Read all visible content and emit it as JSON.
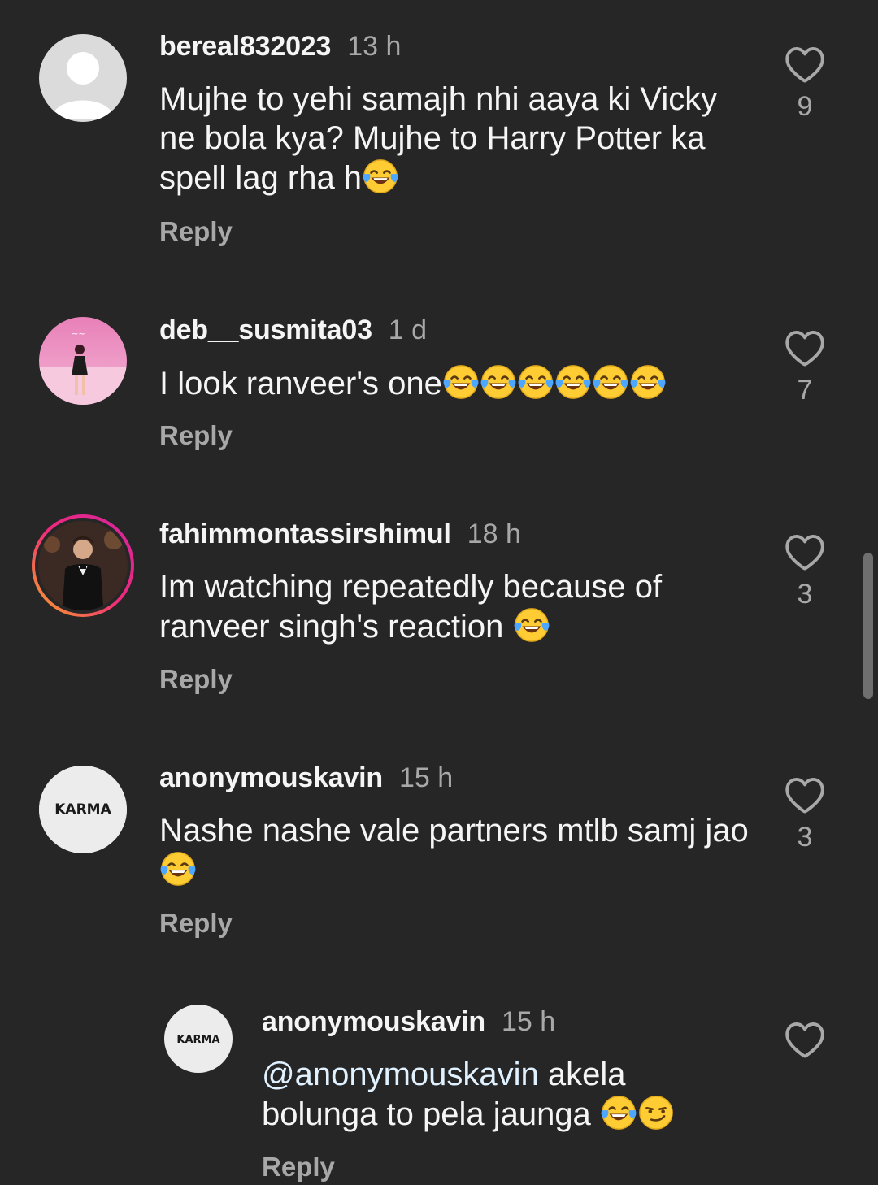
{
  "comments": [
    {
      "username": "bereal832023",
      "time": "13 h",
      "text_before": "Mujhe to yehi samajh nhi aaya ki Vicky ne bola kya? Mujhe to Harry Potter ka spell lag rha h",
      "emojis": [
        "face-with-tears-of-joy"
      ],
      "likes": "9",
      "reply_label": "Reply",
      "avatar": "default-user-avatar"
    },
    {
      "username": "deb__susmita03",
      "time": "1 d",
      "text_before": "I look ranveer's one",
      "emojis": [
        "face-with-tears-of-joy",
        "face-with-tears-of-joy",
        "face-with-tears-of-joy",
        "face-with-tears-of-joy",
        "face-with-tears-of-joy",
        "face-with-tears-of-joy"
      ],
      "likes": "7",
      "reply_label": "Reply",
      "avatar": "pink-room-photo-avatar"
    },
    {
      "username": "fahimmontassirshimul",
      "time": "18 h",
      "text_before": "Im watching repeatedly because of ranveer singh's reaction ",
      "emojis": [
        "face-with-tears-of-joy"
      ],
      "likes": "3",
      "reply_label": "Reply",
      "avatar": "tuxedo-man-story-ring-avatar"
    },
    {
      "username": "anonymouskavin",
      "time": "15 h",
      "text_before": "Nashe nashe vale partners mtlb samj jao ",
      "emojis": [
        "face-with-tears-of-joy"
      ],
      "likes": "3",
      "reply_label": "Reply",
      "avatar": "karma-logo-avatar",
      "avatar_text": "KARMA"
    }
  ],
  "reply": {
    "username": "anonymouskavin",
    "time": "15 h",
    "mention": "@anonymouskavin",
    "text_after": " akela bolunga to pela jaunga ",
    "emojis": [
      "face-with-tears-of-joy",
      "smirking-face"
    ],
    "reply_label": "Reply",
    "avatar": "karma-logo-avatar",
    "avatar_text": "KARMA"
  },
  "colors": {
    "background": "#262626",
    "primary_text": "#f5f5f5",
    "secondary_text": "#a8a8a8",
    "mention": "#e0f1ff",
    "story_ring_start": "#f9a825",
    "story_ring_end": "#d6249f"
  }
}
